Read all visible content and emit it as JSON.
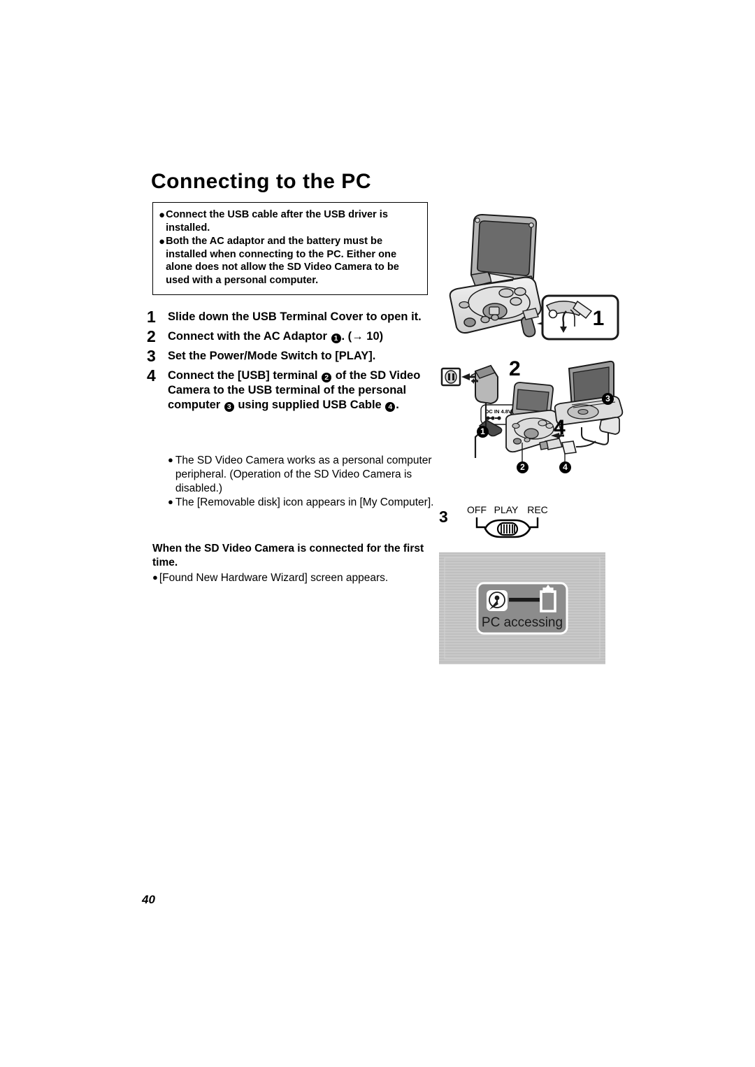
{
  "document": {
    "title": "Connecting to the PC",
    "page_number": "40"
  },
  "notice_box": {
    "bullet_char": "●",
    "items": [
      "Connect the USB cable after the USB driver is installed.",
      "Both the AC adaptor and the battery must be installed when connecting to the PC. Either one alone does not allow the SD Video Camera to be used with a personal computer."
    ]
  },
  "steps": [
    {
      "number": "1",
      "parts": [
        {
          "type": "text",
          "value": "Slide down the USB Terminal Cover to open it."
        }
      ]
    },
    {
      "number": "2",
      "parts": [
        {
          "type": "text",
          "value": "Connect with the AC Adaptor "
        },
        {
          "type": "circled",
          "value": "1"
        },
        {
          "type": "text",
          "value": ". ("
        },
        {
          "type": "arrow",
          "value": "→"
        },
        {
          "type": "text",
          "value": " 10)"
        }
      ]
    },
    {
      "number": "3",
      "parts": [
        {
          "type": "text",
          "value": "Set the Power/Mode Switch to [PLAY]."
        }
      ]
    },
    {
      "number": "4",
      "parts": [
        {
          "type": "text",
          "value": "Connect the [USB] terminal "
        },
        {
          "type": "circled",
          "value": "2"
        },
        {
          "type": "text",
          "value": " of the SD Video Camera to the USB terminal of the personal computer "
        },
        {
          "type": "circled",
          "value": "3"
        },
        {
          "type": "text",
          "value": " using supplied USB Cable "
        },
        {
          "type": "circled",
          "value": "4"
        },
        {
          "type": "text",
          "value": "."
        }
      ]
    }
  ],
  "sub_bullets": {
    "bullet_char": "●",
    "items": [
      "The SD Video Camera works as a personal computer peripheral. (Operation of the SD Video Camera is disabled.)",
      "The [Removable disk] icon appears in [My Computer]."
    ]
  },
  "first_time": {
    "heading": "When the SD Video Camera is connected for the first time.",
    "bullet_char": "●",
    "items": [
      "[Found New Hardware Wizard] screen appears."
    ]
  },
  "figures": {
    "camera_callout": {
      "label": "1"
    },
    "connection": {
      "step_label": "2",
      "cable_label": "4",
      "dc_in_label": "DC IN 4.8V",
      "markers": [
        {
          "id": "1",
          "meaning": "ac-adaptor"
        },
        {
          "id": "2",
          "meaning": "usb-terminal-camera"
        },
        {
          "id": "3",
          "meaning": "personal-computer"
        },
        {
          "id": "4",
          "meaning": "usb-cable"
        }
      ]
    },
    "power_mode_switch": {
      "step_label": "3",
      "positions": [
        "OFF",
        "PLAY",
        "REC"
      ],
      "selected": "PLAY"
    },
    "lcd_screen": {
      "message": "PC accessing",
      "background_color": "#c8c8c8",
      "panel_color": "#8c8c8c"
    }
  }
}
